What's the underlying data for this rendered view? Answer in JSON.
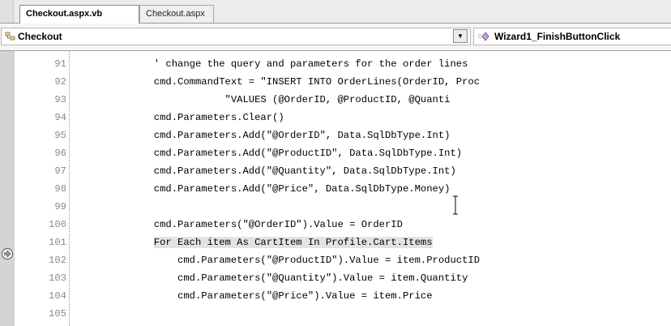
{
  "tabs": [
    {
      "label": "Checkout.aspx.vb",
      "active": true
    },
    {
      "label": "Checkout.aspx",
      "active": false
    }
  ],
  "navbar": {
    "class_name": "Checkout",
    "class_icon": "class-icon",
    "dropdown_icon": "chevron-down-icon",
    "method_name": "Wizard1_FinishButtonClick",
    "method_icon": "method-icon"
  },
  "editor": {
    "breakpoint_line": "101",
    "lines": [
      {
        "num": "91",
        "code": "            ' change the query and parameters for the order lines"
      },
      {
        "num": "92",
        "code": "            cmd.CommandText = \"INSERT INTO OrderLines(OrderID, Proc"
      },
      {
        "num": "93",
        "code": "                        \"VALUES (@OrderID, @ProductID, @Quanti"
      },
      {
        "num": "94",
        "code": "            cmd.Parameters.Clear()"
      },
      {
        "num": "95",
        "code": "            cmd.Parameters.Add(\"@OrderID\", Data.SqlDbType.Int)"
      },
      {
        "num": "96",
        "code": "            cmd.Parameters.Add(\"@ProductID\", Data.SqlDbType.Int)"
      },
      {
        "num": "97",
        "code": "            cmd.Parameters.Add(\"@Quantity\", Data.SqlDbType.Int)"
      },
      {
        "num": "98",
        "code": "            cmd.Parameters.Add(\"@Price\", Data.SqlDbType.Money)"
      },
      {
        "num": "99",
        "code": ""
      },
      {
        "num": "100",
        "code": "            cmd.Parameters(\"@OrderID\").Value = OrderID"
      },
      {
        "num": "101",
        "code": "            For Each item As CartItem In Profile.Cart.Items"
      },
      {
        "num": "102",
        "code": "                cmd.Parameters(\"@ProductID\").Value = item.ProductID"
      },
      {
        "num": "103",
        "code": "                cmd.Parameters(\"@Quantity\").Value = item.Quantity"
      },
      {
        "num": "104",
        "code": "                cmd.Parameters(\"@Price\").Value = item.Price"
      },
      {
        "num": "105",
        "code": ""
      }
    ]
  },
  "colors": {
    "line_number": "#8a8a8a",
    "highlight": "#e3e3e3",
    "margin": "#d4d4d4"
  }
}
